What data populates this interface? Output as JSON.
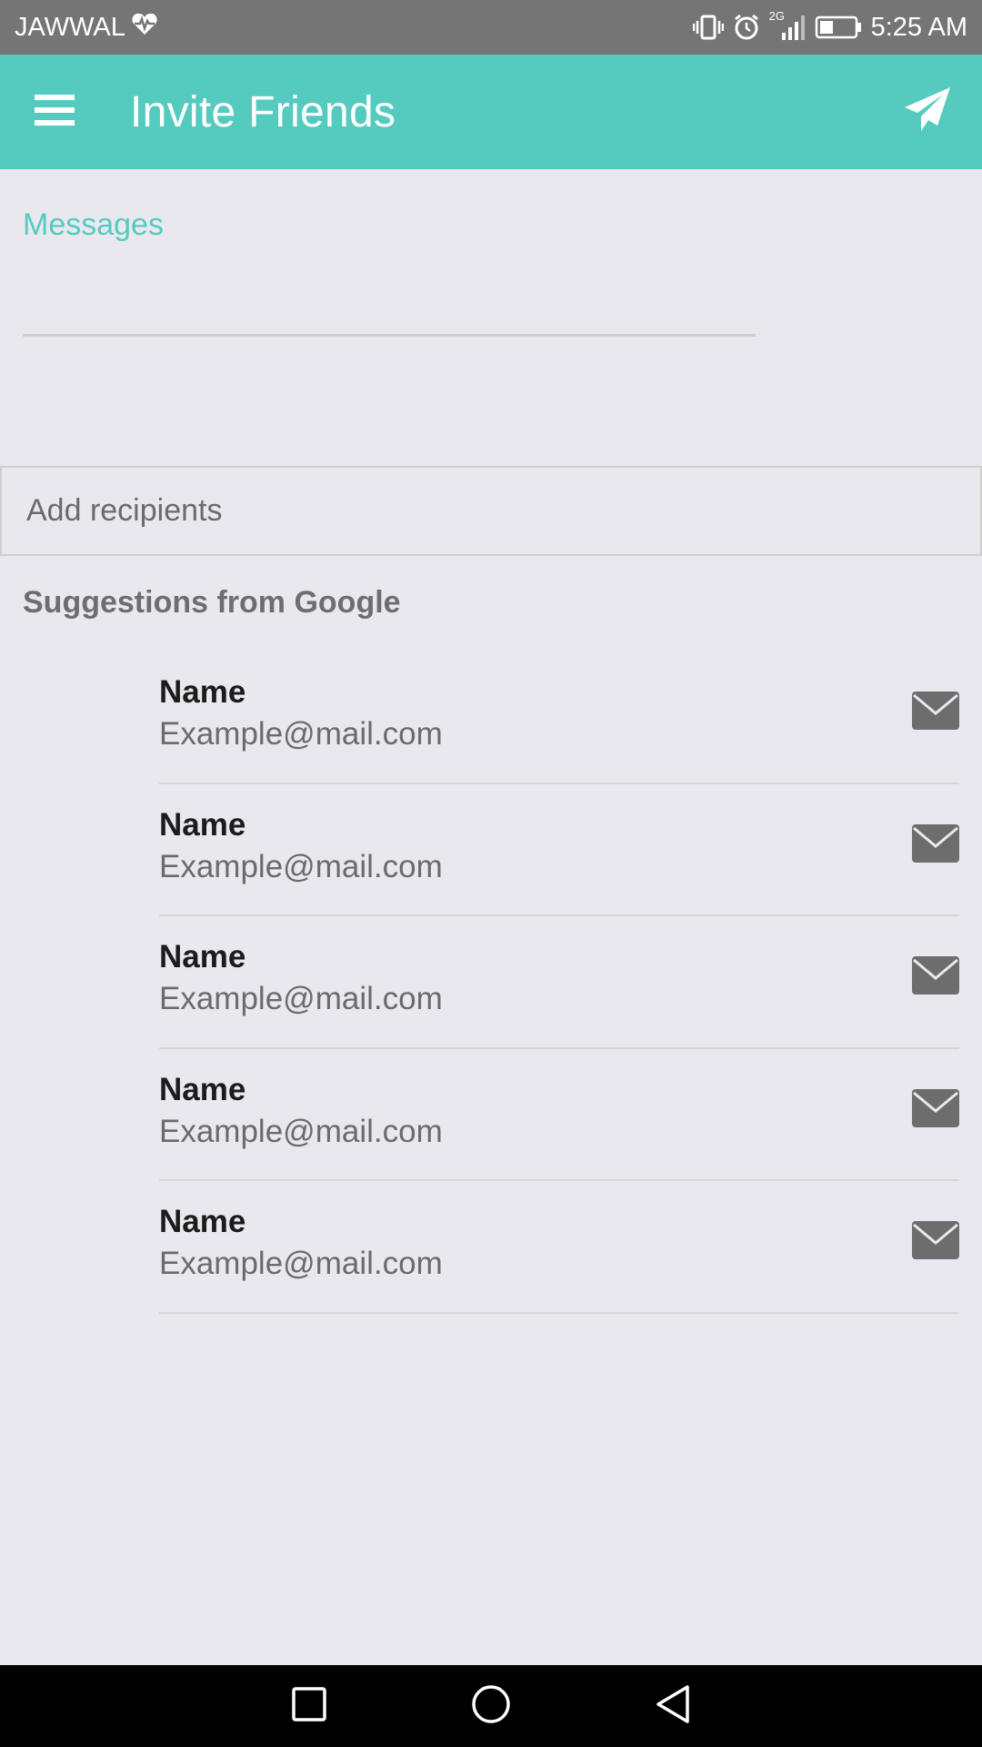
{
  "status_bar": {
    "carrier": "JAWWAL",
    "network": "2G",
    "time": "5:25 AM",
    "icons": [
      "heart-pulse-icon",
      "vibrate-icon",
      "alarm-icon",
      "signal-icon",
      "battery-icon"
    ]
  },
  "app_bar": {
    "title": "Invite Friends",
    "color": "#55cbc0",
    "icons": [
      "menu-icon",
      "send-icon"
    ]
  },
  "message_field": {
    "label": "Messages",
    "value": ""
  },
  "recipients": {
    "placeholder": "Add recipients",
    "value": ""
  },
  "suggestions": {
    "header": "Suggestions from Google",
    "contacts": [
      {
        "name": "Name",
        "email": "Example@mail.com"
      },
      {
        "name": "Name",
        "email": "Example@mail.com"
      },
      {
        "name": "Name",
        "email": "Example@mail.com"
      },
      {
        "name": "Name",
        "email": "Example@mail.com"
      },
      {
        "name": "Name",
        "email": "Example@mail.com"
      }
    ],
    "row_icon": "mail-icon"
  },
  "nav_bar": {
    "icons": [
      "recents-icon",
      "home-icon",
      "back-icon"
    ]
  }
}
